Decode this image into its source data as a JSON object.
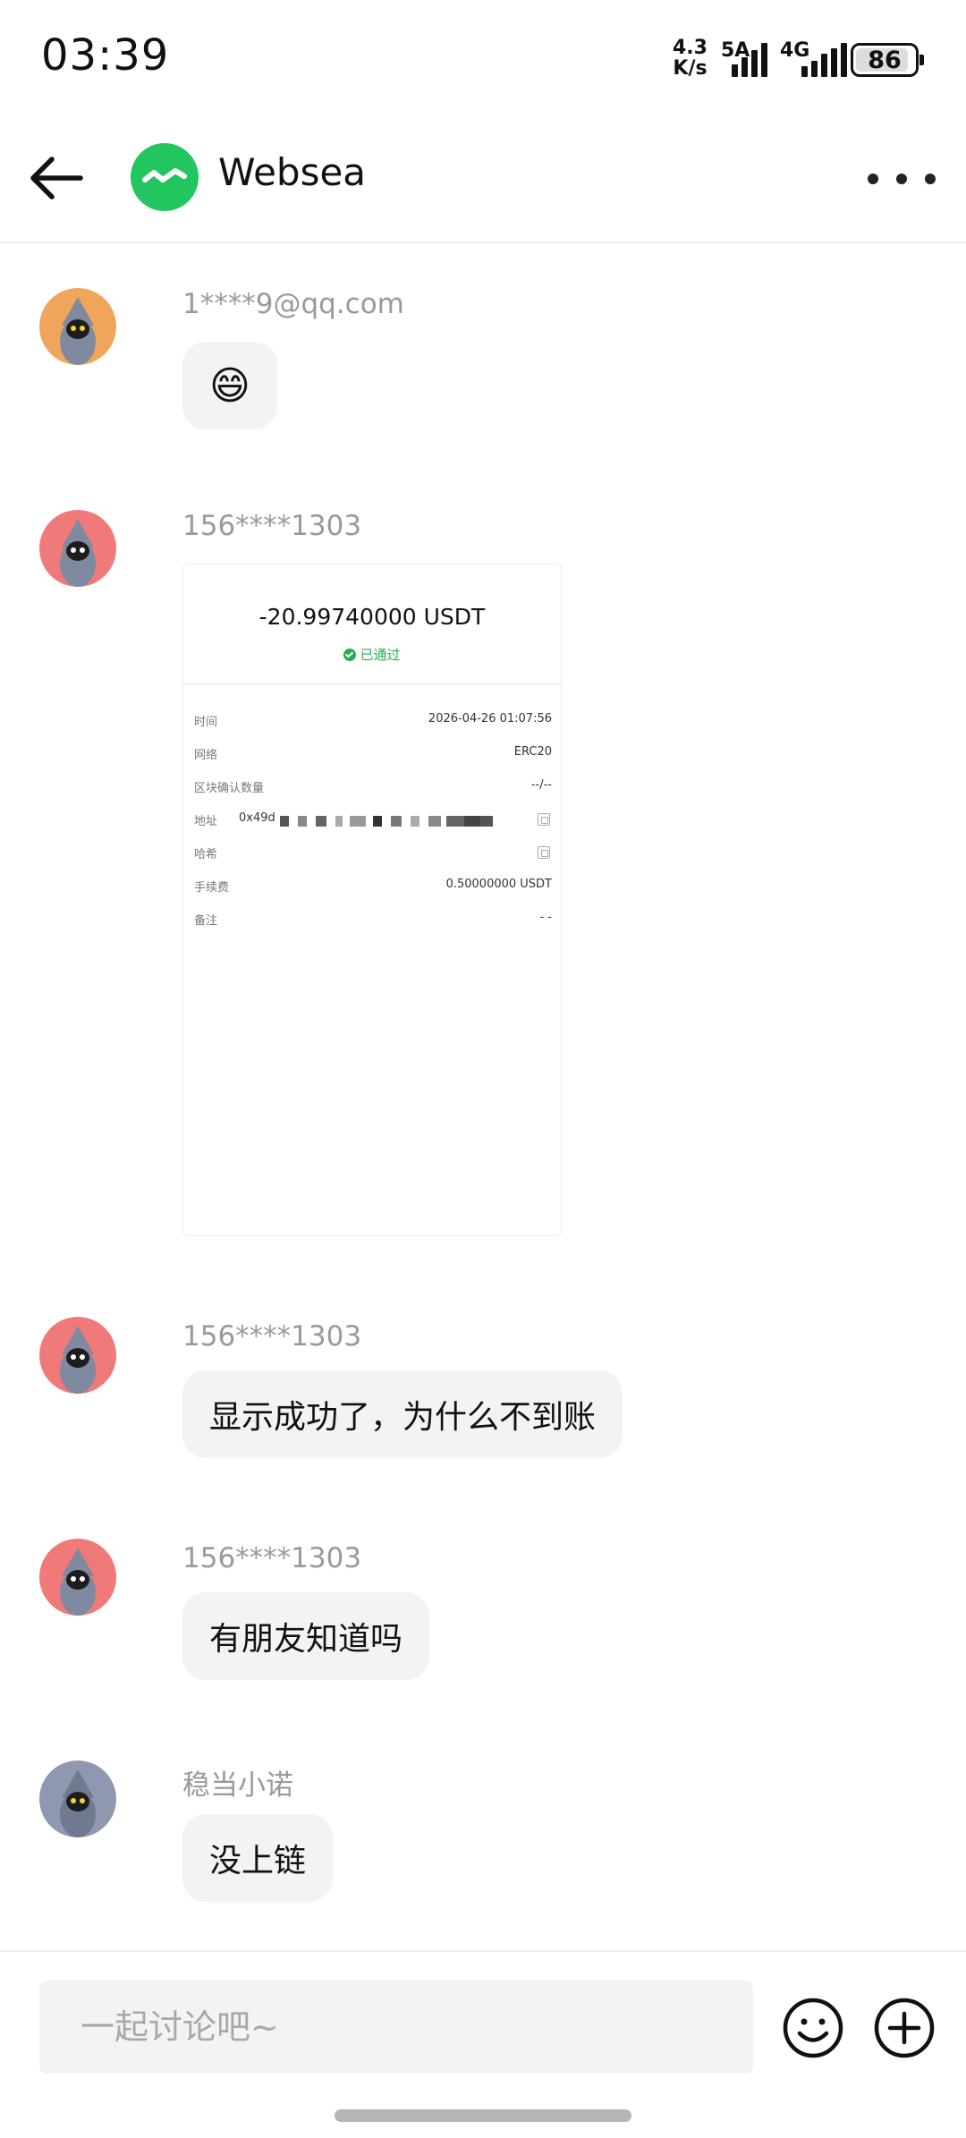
{
  "status_bar": {
    "time": "03:39",
    "net_speed_value": "4.3",
    "net_speed_unit": "K/s",
    "network_1": "5A",
    "network_2": "4G",
    "battery": "86"
  },
  "header": {
    "title": "Websea",
    "back_icon": "arrow-left-icon",
    "more_icon": "more-horizontal-icon",
    "logo_color": "#22c55e"
  },
  "messages": [
    {
      "sender": "1****9@qq.com",
      "text": "😄",
      "avatar_bg": "#f0a65a"
    },
    {
      "sender": "156****1303",
      "type": "image",
      "avatar_bg": "#f07a7a"
    },
    {
      "sender": "156****1303",
      "text": "显示成功了，为什么不到账",
      "avatar_bg": "#f07a7a"
    },
    {
      "sender": "156****1303",
      "text": "有朋友知道吗",
      "avatar_bg": "#f07a7a"
    },
    {
      "sender": "稳当小诺",
      "text": "没上链",
      "avatar_bg": "#8f98b0"
    }
  ],
  "screenshot": {
    "amount": "-20.99740000 USDT",
    "status": "已通过",
    "rows": [
      {
        "label": "时间",
        "value": "2026-04-26 01:07:56"
      },
      {
        "label": "网络",
        "value": "ERC20"
      },
      {
        "label": "区块确认数量",
        "value": "--/--"
      },
      {
        "label": "地址",
        "value": "0x49d"
      },
      {
        "label": "哈希",
        "value": ""
      },
      {
        "label": "手续费",
        "value": "0.50000000 USDT"
      },
      {
        "label": "备注",
        "value": "- -"
      }
    ]
  },
  "input": {
    "placeholder": "一起讨论吧~",
    "emoji_icon": "smile-icon",
    "add_icon": "plus-circle-icon"
  }
}
